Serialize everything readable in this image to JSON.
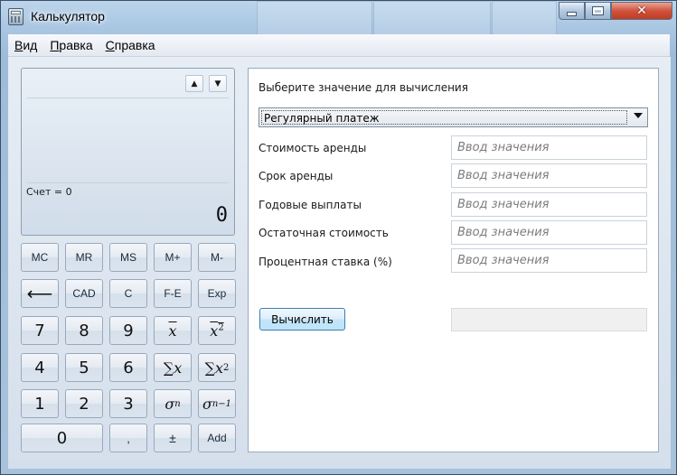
{
  "window": {
    "title": "Калькулятор"
  },
  "menu": [
    {
      "label_ul": "В",
      "label_rest": "ид"
    },
    {
      "label_ul": "П",
      "label_rest": "равка"
    },
    {
      "label_ul": "С",
      "label_rest": "правка"
    }
  ],
  "display": {
    "count": "Счет = 0",
    "value": "0"
  },
  "keys": {
    "mc": "MC",
    "mr": "MR",
    "ms": "MS",
    "mplus": "M+",
    "mminus": "M-",
    "cad": "CAD",
    "c": "C",
    "fe": "F-E",
    "exp": "Exp",
    "d7": "7",
    "d8": "8",
    "d9": "9",
    "d4": "4",
    "d5": "5",
    "d6": "6",
    "d1": "1",
    "d2": "2",
    "d3": "3",
    "d0": "0",
    "comma": ",",
    "plusminus": "±",
    "add": "Add",
    "mean": "x",
    "mean_sq": "x",
    "mean_sq_exp": "2",
    "sum": "∑x",
    "sum_sq": "∑x",
    "sum_sq_exp": "2",
    "sigma": "σ",
    "sigma_sub": "n",
    "sigma1": "σ",
    "sigma1_sub": "n−1"
  },
  "panel": {
    "title": "Выберите значение для вычисления",
    "selected_option": "Регулярный платеж",
    "fields": [
      {
        "label": "Стоимость аренды",
        "placeholder": "Ввод значения"
      },
      {
        "label": "Срок аренды",
        "placeholder": "Ввод значения"
      },
      {
        "label": "Годовые выплаты",
        "placeholder": "Ввод значения"
      },
      {
        "label": "Остаточная стоимость",
        "placeholder": "Ввод значения"
      },
      {
        "label": "Процентная ставка (%)",
        "placeholder": "Ввод значения"
      }
    ],
    "calculate_label": "Вычислить",
    "result": ""
  }
}
